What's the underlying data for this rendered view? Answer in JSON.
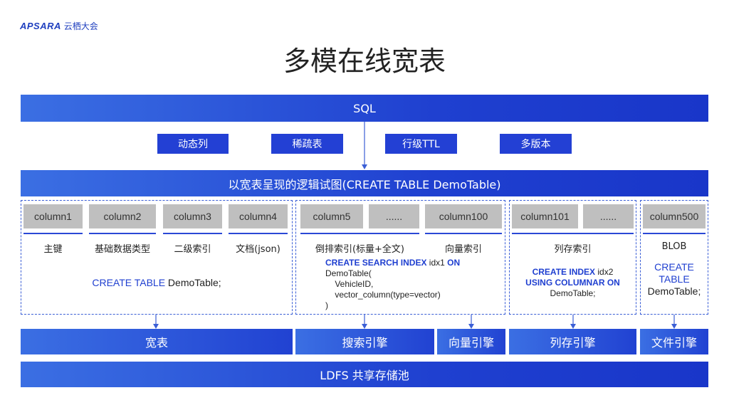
{
  "logo": {
    "brand": "APSARA",
    "text": "云栖大会"
  },
  "title": "多模在线宽表",
  "sql_bar": "SQL",
  "features": [
    "动态列",
    "稀疏表",
    "行级TTL",
    "多版本"
  ],
  "logical_view": "以宽表呈现的逻辑试图(CREATE TABLE DemoTable)",
  "groups": {
    "wide": {
      "columns": [
        "column1",
        "column2",
        "column3",
        "column4"
      ],
      "labels": [
        "主键",
        "基础数据类型",
        "二级索引",
        "文档(json)"
      ],
      "sql_keyword": "CREATE TABLE",
      "sql_rest": " DemoTable;"
    },
    "search": {
      "columns": [
        "column5",
        "......",
        "column100"
      ],
      "labels": [
        "倒排索引(标量+全文)",
        "向量索引"
      ],
      "sql_kw1": "CREATE SEARCH INDEX",
      "sql_mid": " idx1 ",
      "sql_kw2": "ON",
      "sql_line2": "DemoTable(",
      "sql_line3": "    VehicleID,",
      "sql_line4": "    vector_column(type=vector)",
      "sql_line5": ")"
    },
    "columnar": {
      "columns": [
        "column101",
        "......"
      ],
      "label": "列存索引",
      "sql_kw1": "CREATE INDEX",
      "sql_mid": " idx2",
      "sql_kw2": "USING COLUMNAR ON",
      "sql_line3": "DemoTable;"
    },
    "file": {
      "column": "column500",
      "label": "BLOB",
      "sql_kw1": "CREATE",
      "sql_kw2": "TABLE",
      "sql_line3": "DemoTable;"
    }
  },
  "engines": [
    "宽表",
    "搜索引擎",
    "向量引擎",
    "列存引擎",
    "文件引擎"
  ],
  "storage": "LDFS 共享存储池",
  "colors": {
    "accent": "#1f40d0",
    "column_bg": "#bfbfbf",
    "dash": "#3b5fd6"
  }
}
